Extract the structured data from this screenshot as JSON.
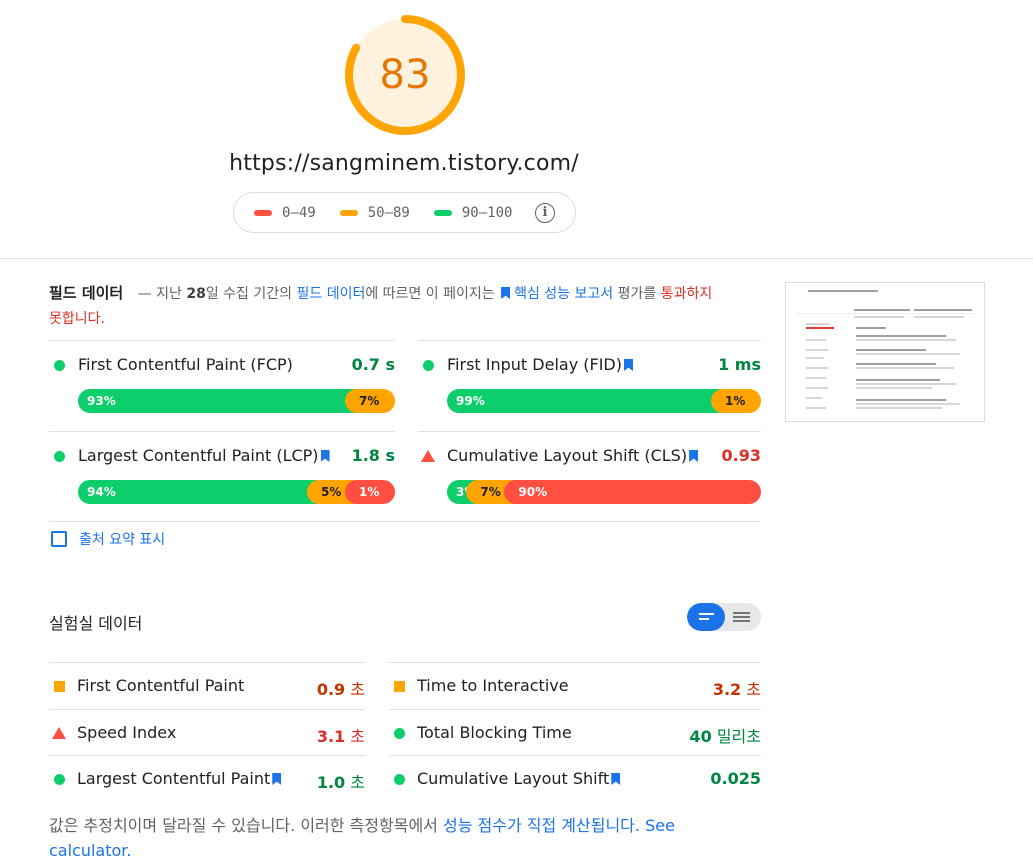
{
  "summary": {
    "score": "83",
    "score_fraction": 0.83,
    "score_color": "#ffa400",
    "url": "https://sangminem.tistory.com/",
    "legend": [
      {
        "range": "0–49",
        "color": "#ff4e42"
      },
      {
        "range": "50–89",
        "color": "#ffa400"
      },
      {
        "range": "90–100",
        "color": "#0cce6b"
      }
    ],
    "info_icon": "info-icon"
  },
  "field": {
    "title": "필드 데이터",
    "desc_dash": "— 지난",
    "desc_days": "28",
    "desc_mid": "일 수집 기간의",
    "desc_link": "필드 데이터",
    "desc_mid2": "에 따르면 이 페이지는",
    "desc_link2": "핵심 성능 보고서",
    "desc_mid3": "평가를",
    "desc_result": "통과하지 못합니다.",
    "metrics": [
      {
        "name": "First Contentful Paint (FCP)",
        "value": "0.7 s",
        "status": "pass",
        "bookmark": false,
        "dist": [
          {
            "label": "93%",
            "pct": 93
          },
          {
            "label": "7%",
            "pct": 7
          }
        ]
      },
      {
        "name": "First Input Delay (FID)",
        "value": "1 ms",
        "status": "pass",
        "bookmark": true,
        "dist": [
          {
            "label": "99%",
            "pct": 99
          },
          {
            "label": "1%",
            "pct": 1
          }
        ]
      },
      {
        "name": "Largest Contentful Paint (LCP)",
        "value": "1.8 s",
        "status": "pass",
        "bookmark": true,
        "dist": [
          {
            "label": "94%",
            "pct": 94
          },
          {
            "label": "5%",
            "pct": 5
          },
          {
            "label": "1%",
            "pct": 1
          }
        ]
      },
      {
        "name": "Cumulative Layout Shift (CLS)",
        "value": "0.93",
        "status": "fail",
        "bookmark": true,
        "dist": [
          {
            "label": "3%",
            "pct": 3
          },
          {
            "label": "7%",
            "pct": 7
          },
          {
            "label": "90%",
            "pct": 90
          }
        ]
      }
    ],
    "origin_summary": "출처 요약 표시"
  },
  "lab": {
    "title": "실험실 데이터",
    "metrics": [
      {
        "name": "First Contentful Paint",
        "num": "0.9",
        "unit": "초",
        "status": "average",
        "bookmark": false
      },
      {
        "name": "Time to Interactive",
        "num": "3.2",
        "unit": "초",
        "status": "average",
        "bookmark": false
      },
      {
        "name": "Speed Index",
        "num": "3.1",
        "unit": "초",
        "status": "fail",
        "bookmark": false
      },
      {
        "name": "Total Blocking Time",
        "num": "40",
        "unit": "밀리초",
        "status": "pass",
        "bookmark": false
      },
      {
        "name": "Largest Contentful Paint",
        "num": "1.0",
        "unit": "초",
        "status": "pass",
        "bookmark": true
      },
      {
        "name": "Cumulative Layout Shift",
        "num": "0.025",
        "unit": "",
        "status": "pass",
        "bookmark": true
      }
    ],
    "note_text": "값은 추정치이며 달라질 수 있습니다. 이러한 측정항목에서",
    "note_link": "성능 점수가 직접 계산됩니다.",
    "note_link2": "See calculator."
  },
  "colors": {
    "pass": "#0cce6b",
    "average": "#ffa400",
    "fail": "#ff4e42",
    "link": "#1a73e8"
  }
}
